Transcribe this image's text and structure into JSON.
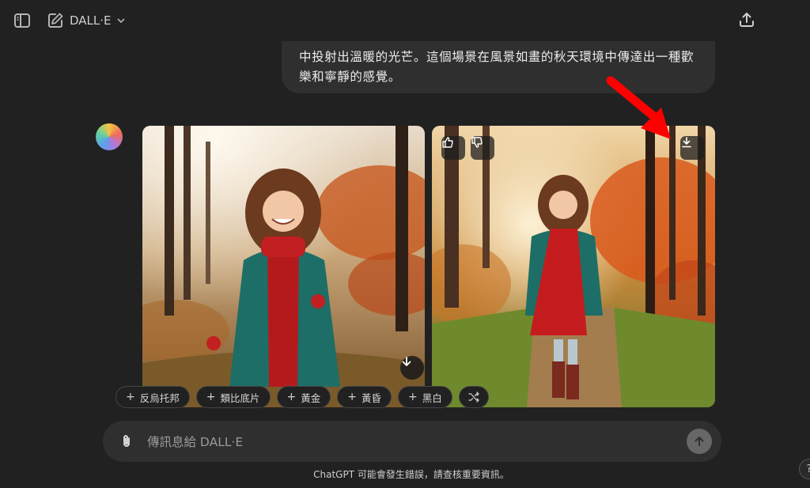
{
  "header": {
    "model_label": "DALL·E"
  },
  "message": {
    "user_text_line1": "中投射出溫暖的光芒。這個場景在風景如畫的秋天環境中傳達出一種歡",
    "user_text_line2": "樂和寧靜的感覺。"
  },
  "style_chips": [
    {
      "label": "反烏托邦"
    },
    {
      "label": "類比底片"
    },
    {
      "label": "黃金"
    },
    {
      "label": "黃昏"
    },
    {
      "label": "黑白"
    }
  ],
  "composer": {
    "placeholder": "傳訊息給 DALL·E"
  },
  "footer": {
    "note": "ChatGPT 可能會發生錯誤，請查核重要資訊。",
    "help_label": "?"
  },
  "colors": {
    "background": "#212121",
    "bubble": "#2f2f2f",
    "annotation_arrow": "#ff0000"
  }
}
